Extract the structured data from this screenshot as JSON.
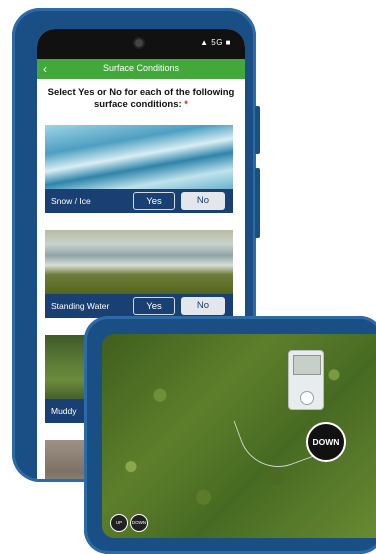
{
  "phone": {
    "status": {
      "signal_text": "▲ 5G ■"
    },
    "appbar": {
      "title": "Surface Conditions",
      "back_glyph": "‹"
    },
    "prompt": {
      "text": "Select Yes or No for each of the following surface conditions:",
      "required_mark": "*"
    },
    "cards": [
      {
        "label": "Snow / Ice",
        "yes": "Yes",
        "no": "No",
        "image": "ice-photo"
      },
      {
        "label": "Standing Water",
        "yes": "Yes",
        "no": "No",
        "image": "water-photo"
      },
      {
        "label": "Muddy",
        "yes": "",
        "no": "",
        "image": "mud-photo"
      },
      {
        "label": "",
        "yes": "",
        "no": "",
        "image": "gravel-photo"
      }
    ]
  },
  "tablet": {
    "overlay": {
      "down_label": "DOWN",
      "mini_left": "UP",
      "mini_right": "DOWN"
    }
  },
  "colors": {
    "frame": "#1a4f86",
    "appbar": "#43a83a",
    "label_bar": "#1a3f72"
  }
}
